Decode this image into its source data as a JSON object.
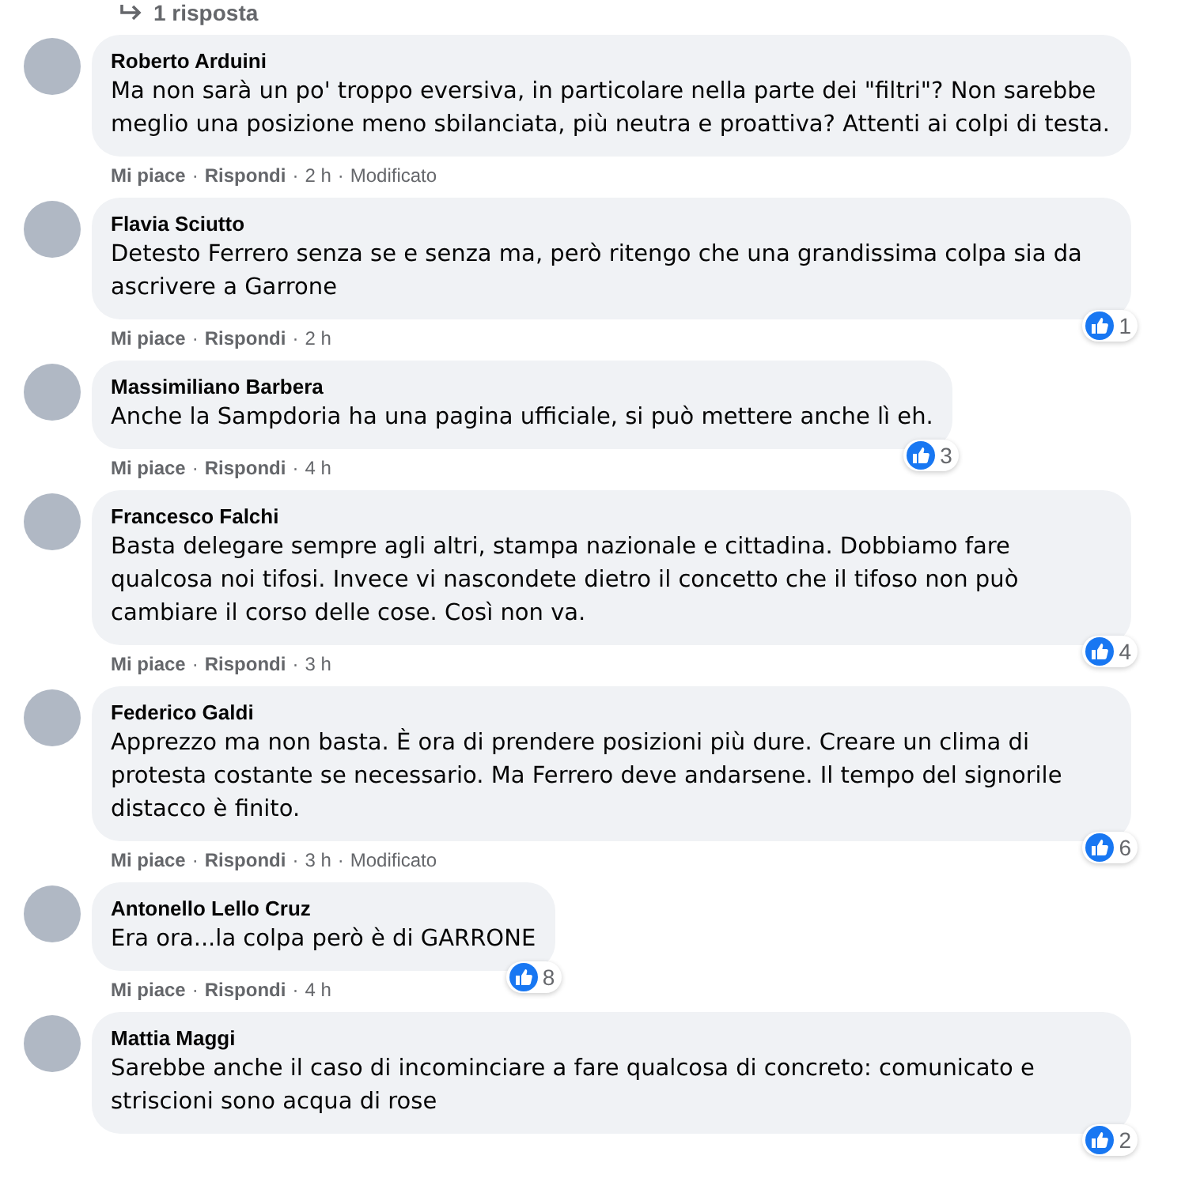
{
  "replies_link": {
    "label": "1 risposta"
  },
  "comments": [
    {
      "author": "Roberto Arduini",
      "text": "Ma non sarà un po' troppo eversiva, in particolare nella parte dei \"filtri\"? Non sarebbe meglio una posizione meno sbilanciata, più neutra e proattiva? Attenti ai colpi di testa.",
      "meta": [
        {
          "kind": "like",
          "text": "Mi piace"
        },
        {
          "kind": "separator",
          "text": "·"
        },
        {
          "kind": "reply",
          "text": "Rispondi"
        },
        {
          "kind": "separator",
          "text": "·"
        },
        {
          "kind": "time",
          "text": "2 h"
        },
        {
          "kind": "separator",
          "text": "·"
        },
        {
          "kind": "edited",
          "text": "Modificato"
        }
      ]
    },
    {
      "author": "Flavia Sciutto",
      "text": "Detesto Ferrero senza se e senza ma, però ritengo che una grandissima colpa sia da ascrivere a Garrone",
      "reactions": "1",
      "meta": [
        {
          "kind": "like",
          "text": "Mi piace"
        },
        {
          "kind": "separator",
          "text": "·"
        },
        {
          "kind": "reply",
          "text": "Rispondi"
        },
        {
          "kind": "separator",
          "text": "·"
        },
        {
          "kind": "time",
          "text": "2 h"
        }
      ]
    },
    {
      "author": "Massimiliano Barbera",
      "text": "Anche la Sampdoria ha una pagina ufficiale, si può mettere anche lì eh.",
      "reactions": "3",
      "meta": [
        {
          "kind": "like",
          "text": "Mi piace"
        },
        {
          "kind": "separator",
          "text": "·"
        },
        {
          "kind": "reply",
          "text": "Rispondi"
        },
        {
          "kind": "separator",
          "text": "·"
        },
        {
          "kind": "time",
          "text": "4 h"
        }
      ]
    },
    {
      "author": "Francesco Falchi",
      "text": "Basta delegare sempre agli altri, stampa nazionale e cittadina. Dobbiamo fare qualcosa noi tifosi. Invece vi nascondete dietro il concetto che il tifoso non può cambiare il corso delle cose. Così non va.",
      "reactions": "4",
      "meta": [
        {
          "kind": "like",
          "text": "Mi piace"
        },
        {
          "kind": "separator",
          "text": "·"
        },
        {
          "kind": "reply",
          "text": "Rispondi"
        },
        {
          "kind": "separator",
          "text": "·"
        },
        {
          "kind": "time",
          "text": "3 h"
        }
      ]
    },
    {
      "author": "Federico Galdi",
      "text": "Apprezzo ma non basta. È ora di prendere posizioni più dure. Creare un clima di protesta costante se necessario. Ma Ferrero deve andarsene. Il tempo del signorile distacco è finito.",
      "reactions": "6",
      "meta": [
        {
          "kind": "like",
          "text": "Mi piace"
        },
        {
          "kind": "separator",
          "text": "·"
        },
        {
          "kind": "reply",
          "text": "Rispondi"
        },
        {
          "kind": "separator",
          "text": "·"
        },
        {
          "kind": "time",
          "text": "3 h"
        },
        {
          "kind": "separator",
          "text": "·"
        },
        {
          "kind": "edited",
          "text": "Modificato"
        }
      ]
    },
    {
      "author": "Antonello Lello Cruz",
      "text": "Era ora...la colpa però è di GARRONE",
      "reactions": "8",
      "meta": [
        {
          "kind": "like",
          "text": "Mi piace"
        },
        {
          "kind": "separator",
          "text": "·"
        },
        {
          "kind": "reply",
          "text": "Rispondi"
        },
        {
          "kind": "separator",
          "text": "·"
        },
        {
          "kind": "time",
          "text": "4 h"
        }
      ]
    },
    {
      "author": "Mattia Maggi",
      "text": "Sarebbe anche il caso di incominciare a fare qualcosa di concreto: comunicato e striscioni sono acqua di rose",
      "reactions": "2"
    }
  ]
}
